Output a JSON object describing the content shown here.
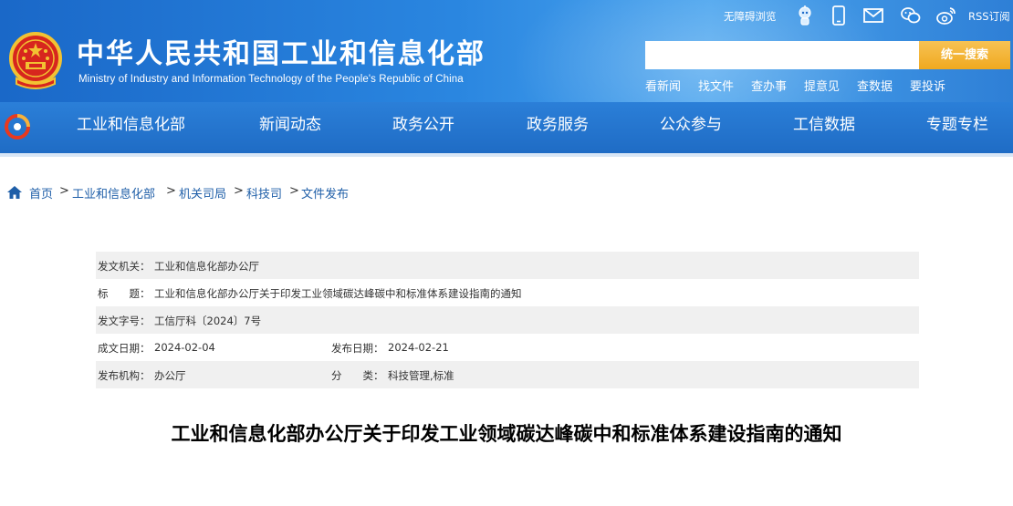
{
  "header": {
    "site_title_cn": "中华人民共和国工业和信息化部",
    "site_title_en": "Ministry of Industry and Information Technology of the People's Republic of China",
    "accessibility_label": "无障碍浏览",
    "rss_label": "RSS订阅",
    "util_icons": [
      "robot-assistant-icon",
      "mobile-icon",
      "mail-icon",
      "wechat-icon",
      "weibo-icon"
    ],
    "search": {
      "placeholder": "",
      "button_label": "统一搜索"
    },
    "quick_links": [
      "看新闻",
      "找文件",
      "查办事",
      "提意见",
      "查数据",
      "要投诉"
    ]
  },
  "nav": {
    "items": [
      "工业和信息化部",
      "新闻动态",
      "政务公开",
      "政务服务",
      "公众参与",
      "工信数据",
      "专题专栏"
    ]
  },
  "breadcrumb": {
    "items": [
      "首页",
      "工业和信息化部",
      "机关司局",
      "科技司",
      "文件发布"
    ],
    "separator": ">"
  },
  "meta": {
    "issuer_label": "发文机关：",
    "issuer_value": "工业和信息化部办公厅",
    "title_label": "标　　题：",
    "title_value": "工业和信息化部办公厅关于印发工业领域碳达峰碳中和标准体系建设指南的通知",
    "doc_no_label": "发文字号：",
    "doc_no_value": "工信厅科〔2024〕7号",
    "created_label": "成文日期：",
    "created_value": "2024-02-04",
    "published_label": "发布日期：",
    "published_value": "2024-02-21",
    "org_label": "发布机构：",
    "org_value": "办公厅",
    "category_label": "分　　类：",
    "category_value": "科技管理,标准"
  },
  "document": {
    "title": "工业和信息化部办公厅关于印发工业领域碳达峰碳中和标准体系建设指南的通知"
  },
  "colors": {
    "header_blue": "#2a86e0",
    "nav_blue": "#1f6cc5",
    "search_button": "#f0a91f",
    "link_blue": "#1e5ea8",
    "row_shade": "#f0f0f0"
  }
}
